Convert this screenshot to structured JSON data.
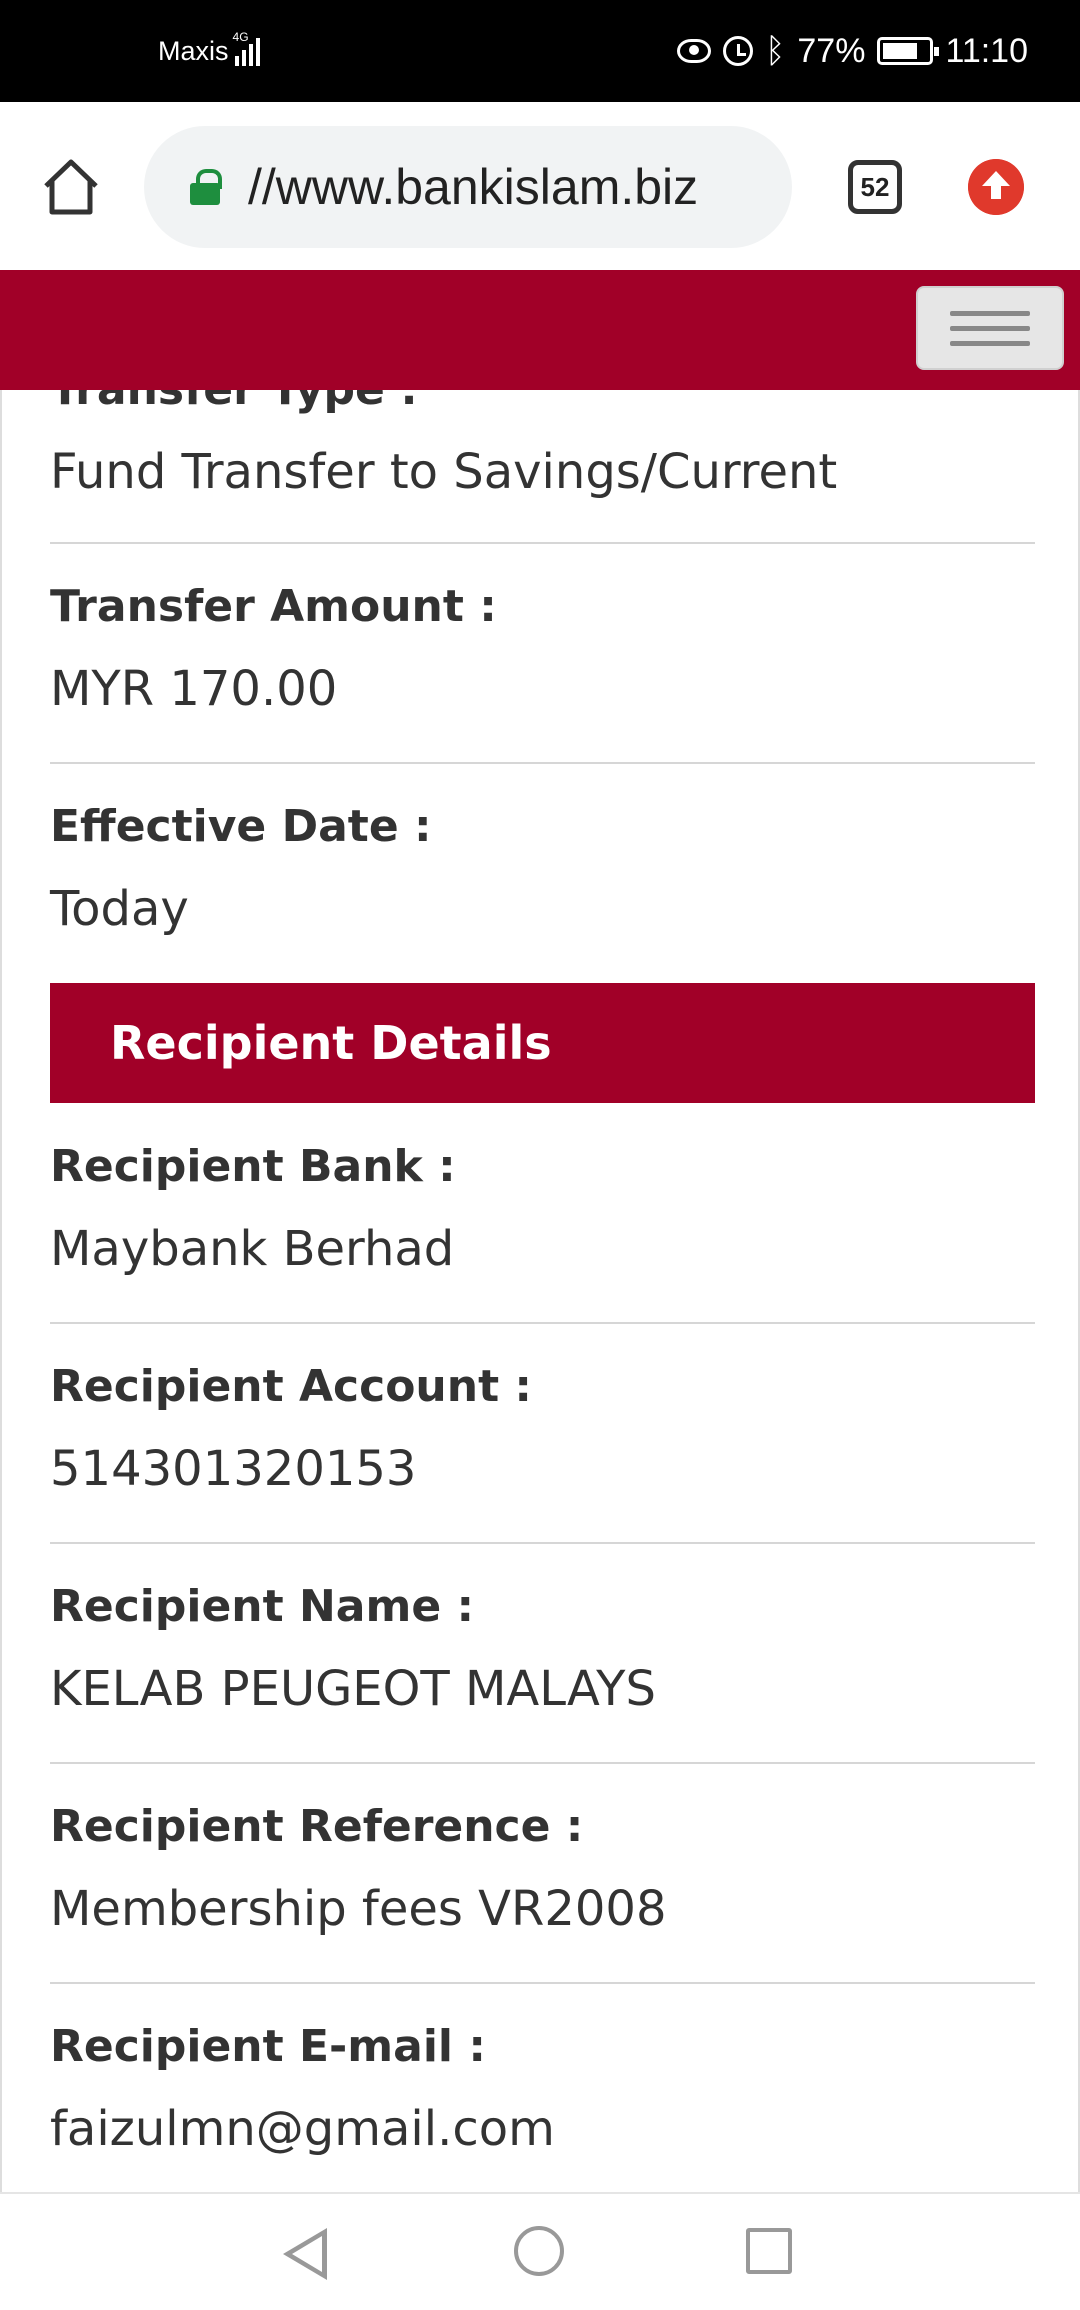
{
  "status_bar": {
    "carrier": "Maxis",
    "network": "4G",
    "battery_percent": "77%",
    "time": "11:10",
    "icons": [
      "eye-comfort-icon",
      "alarm-icon",
      "bluetooth-icon",
      "battery-icon"
    ]
  },
  "browser": {
    "url": "//www.bankislam.biz",
    "tab_count": "52",
    "icons": [
      "home-icon",
      "lock-icon",
      "tabs-icon",
      "update-icon"
    ],
    "update_color": "#e0392c",
    "lock_color": "#1e8e3e"
  },
  "header": {
    "brand_color": "#a10028",
    "menu_icon": "hamburger-menu-icon"
  },
  "transfer": {
    "type_label": "Transfer Type :",
    "type_value": "Fund Transfer to Savings/Current",
    "amount_label": "Transfer Amount :",
    "amount_value": "MYR 170.00",
    "date_label": "Effective Date :",
    "date_value": "Today"
  },
  "recipient": {
    "section_title": "Recipient Details",
    "bank_label": "Recipient Bank :",
    "bank_value": "Maybank Berhad",
    "account_label": "Recipient Account :",
    "account_value": "514301320153",
    "name_label": "Recipient Name :",
    "name_value": "KELAB PEUGEOT MALAYS",
    "reference_label": "Recipient Reference :",
    "reference_value": "Membership fees VR2008",
    "email_label": "Recipient E-mail :",
    "email_value": "faizulmn@gmail.com"
  },
  "nav_bar": {
    "icons": [
      "back-icon",
      "home-circle-icon",
      "recents-icon"
    ]
  }
}
